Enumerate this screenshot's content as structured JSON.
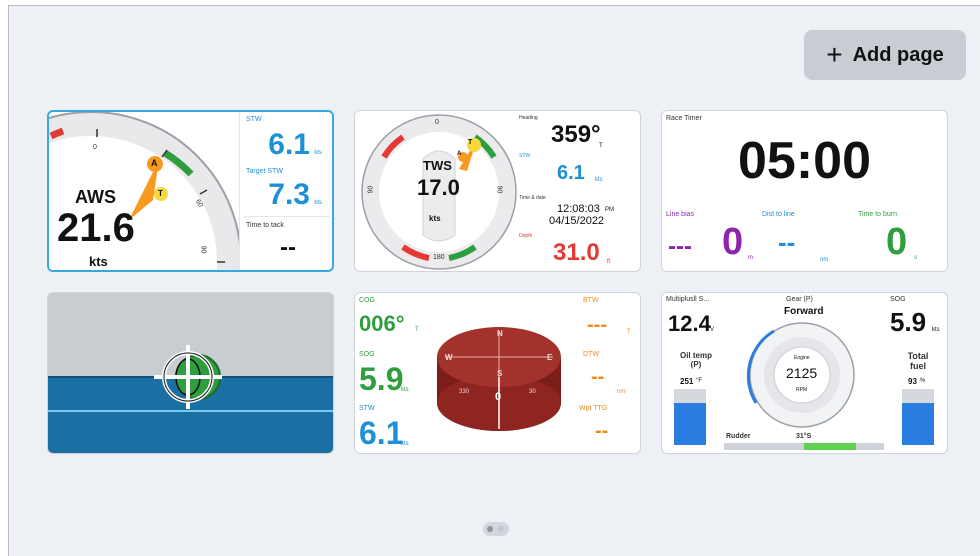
{
  "header": {
    "add_page_label": "Add page"
  },
  "tiles": {
    "wind": {
      "main_label": "AWS",
      "main_value": "21.6",
      "main_unit": "kts",
      "dial_ticks": [
        "0",
        "30",
        "60",
        "90"
      ],
      "pointer_a": "A",
      "pointer_t": "T",
      "stw_label": "STW",
      "stw_value": "6.1",
      "stw_unit": "kts",
      "target_label": "Target STW",
      "target_value": "7.3",
      "target_unit": "kts",
      "tack_label": "Time to tack",
      "tack_value": "--"
    },
    "nav": {
      "tws_label": "TWS",
      "tws_value": "17.0",
      "tws_unit": "kts",
      "dial_ticks": [
        "0",
        "30",
        "60",
        "90",
        "120",
        "150",
        "180",
        "150",
        "120",
        "90",
        "60",
        "30"
      ],
      "pointer_a": "A",
      "pointer_t": "T",
      "heading_label": "Heading",
      "heading_value": "359°",
      "heading_unit": "T",
      "stw_label": "STW",
      "stw_value": "6.1",
      "stw_unit": "kts",
      "time_label": "Time & date",
      "time_value": "12:08:03",
      "time_ampm": "PM",
      "date_value": "04/15/2022",
      "depth_label": "Depth",
      "depth_value": "31.0",
      "depth_unit": "ft"
    },
    "race": {
      "title": "Race Timer",
      "timer": "05:00",
      "line_bias_label": "Line bias",
      "line_bias_dash": "---",
      "line_bias_value": "0",
      "line_bias_unit": "m",
      "dist_label": "Dist to line",
      "dist_value": "--",
      "dist_unit": "nm",
      "burn_label": "Time to burn",
      "burn_value": "0",
      "burn_unit": "s"
    },
    "attitude": {},
    "compass": {
      "cog_label": "COG",
      "cog_value": "006°",
      "cog_unit": "T",
      "sog_label": "SOG",
      "sog_value": "5.9",
      "sog_unit": "kts",
      "stw_label": "STW",
      "stw_value": "6.1",
      "stw_unit": "kts",
      "btw_label": "BTW",
      "btw_value": "---",
      "btw_unit": "T",
      "dtw_label": "DTW",
      "dtw_value": "--",
      "dtw_unit": "nm",
      "ttg_label": "Wpt TTG",
      "ttg_value": "--",
      "rose_n": "N",
      "rose_e": "E",
      "rose_s": "S",
      "rose_w": "W",
      "rose_0": "0",
      "rose_30": "30",
      "rose_330": "330"
    },
    "engine": {
      "title": "Multiplusll S...",
      "volt_value": "12.4",
      "volt_unit": "V",
      "gear_label": "Gear (P)",
      "gear_value": "Forward",
      "sog_label": "SOG",
      "sog_value": "5.9",
      "sog_unit": "kts",
      "oil_label": "Oil temp (P)",
      "oil_value": "251",
      "oil_unit": "°F",
      "engine_label": "Engine",
      "rpm_value": "2125",
      "rpm_unit": "RPM",
      "fuel_label": "Total fuel",
      "fuel_value": "93",
      "fuel_unit": "%",
      "rudder_label": "Rudder",
      "rudder_value": "31°S",
      "oil_fill": 0.75,
      "fuel_fill": 0.75
    }
  },
  "colors": {
    "accent_blue": "#1e90d8",
    "green": "#2f9e3f",
    "red": "#e53935",
    "orange": "#f08a1c",
    "sea": "#1a6fa3",
    "compass_red": "#a3322c"
  }
}
